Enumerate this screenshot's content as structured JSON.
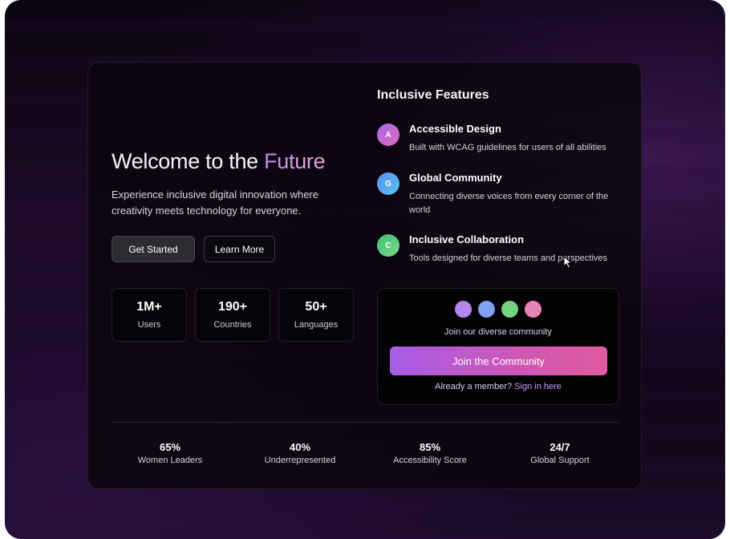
{
  "hero": {
    "title_prefix": "Welcome to the ",
    "title_accent": "Future",
    "description": "Experience inclusive digital innovation where creativity meets technology for everyone.",
    "primary_button": "Get Started",
    "secondary_button": "Learn More"
  },
  "stats": [
    {
      "value": "1M+",
      "label": "Users"
    },
    {
      "value": "190+",
      "label": "Countries"
    },
    {
      "value": "50+",
      "label": "Languages"
    }
  ],
  "features": {
    "title": "Inclusive Features",
    "items": [
      {
        "letter": "A",
        "title": "Accessible Design",
        "description": "Built with WCAG guidelines for users of all abilities",
        "color": "#c06ad8"
      },
      {
        "letter": "G",
        "title": "Global Community",
        "description": "Connecting diverse voices from every corner of the world",
        "color": "#5aa6ee"
      },
      {
        "letter": "C",
        "title": "Inclusive Collaboration",
        "description": "Tools designed for diverse teams and perspectives",
        "color": "#4fc97a"
      }
    ]
  },
  "community": {
    "dot_colors": [
      "#b487ef",
      "#7fa3ef",
      "#72d47f",
      "#e484b3"
    ],
    "text": "Join our diverse community",
    "button": "Join the Community",
    "member_prefix": "Already a member?",
    "member_link": "Sign in here"
  },
  "bottom_stats": [
    {
      "value": "65%",
      "label": "Women Leaders"
    },
    {
      "value": "40%",
      "label": "Underrepresented"
    },
    {
      "value": "85%",
      "label": "Accessibility Score"
    },
    {
      "value": "24/7",
      "label": "Global Support"
    }
  ]
}
